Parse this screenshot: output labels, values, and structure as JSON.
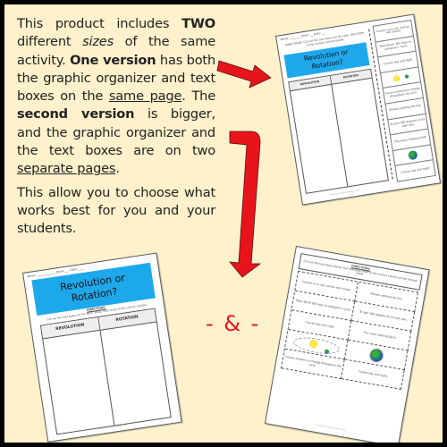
{
  "description": {
    "paragraph1": [
      {
        "text": "This product includes ",
        "style": "normal"
      },
      {
        "text": "TWO",
        "style": "bold"
      },
      {
        "text": " different ",
        "style": "normal"
      },
      {
        "text": "sizes",
        "style": "italic"
      },
      {
        "text": " of the same activity. ",
        "style": "normal"
      },
      {
        "text": "One version",
        "style": "bold"
      },
      {
        "text": " has both the graphic organizer and text boxes on the ",
        "style": "normal"
      },
      {
        "text": "same page",
        "style": "underline"
      },
      {
        "text": ". The ",
        "style": "normal"
      },
      {
        "text": "second version",
        "style": "bold"
      },
      {
        "text": " is bigger, and the graphic organizer and the text boxes are on two ",
        "style": "normal"
      },
      {
        "text": "separate pages",
        "style": "underline"
      },
      {
        "text": ".",
        "style": "normal"
      }
    ],
    "paragraph2": "This allow you to choose what works best for you and your students."
  },
  "separator": "- & -",
  "colors": {
    "background": "#fef1cc",
    "border": "#000000",
    "arrow": "#e8141c",
    "banner": "#1ea8ec"
  },
  "page_small": {
    "name_label": "Name:",
    "block_label": "Block:",
    "date_label": "Date:",
    "directions": "DIRECTIONS: Cut out the text boxes on the side. Glue them in the correct column below.",
    "title_line1": "Revolution or",
    "title_line2": "Rotation?",
    "col1": "REVOLUTION",
    "col2": "ROTATION",
    "cut_boxes": [
      "Causes us to see sunrise and sunset",
      "Takes Earth 365 days to complete 1 cycle",
      "Causes day and night",
      "[sun-earth-orbit-image]",
      "Causes seasons to change throughout the year",
      "Planets orbiting the Sun",
      "To spin 360 degrees on its own axis",
      "The moon orbiting Earth",
      "[earth-image]",
      "Causes day and night"
    ],
    "footer": "© 2016 The Science Teacher Store"
  },
  "page_organizer": {
    "name_label": "Name:",
    "block_label": "Block:",
    "date_label": "Date:",
    "title_line1": "Revolution or",
    "title_line2": "Rotation?",
    "directions_title": "DIRECTIONS:",
    "directions": "Cut out the text boxes on the NEXT PAGE. Glue them in the correct column.",
    "col1": "REVOLUTION",
    "col2": "ROTATION",
    "footer": "© 2016 The Science Teacher Store"
  },
  "page_textboxes": {
    "directions_title": "DIRECTIONS:",
    "directions": "Cut out the text boxes below. Sort and glue them in the correct column on the answer sheet.",
    "cells": [
      [
        "Causes us to see sunrise and sunset",
        "Planets orbiting the Sun"
      ],
      [
        "Takes Earth 365 days to complete 1 cycle",
        "To spin 360 degrees on its own axis"
      ],
      [
        "Causes day and night",
        "The moon orbiting Earth"
      ],
      [
        "[sun-earth-orbit-image]",
        "[earth-image]"
      ],
      [
        "Causes seasons to change throughout the year",
        "Causes day and night"
      ]
    ],
    "sun_label": "Sun",
    "earth_label": "Earth",
    "footer": "© 2016 The Science Teacher Store"
  }
}
